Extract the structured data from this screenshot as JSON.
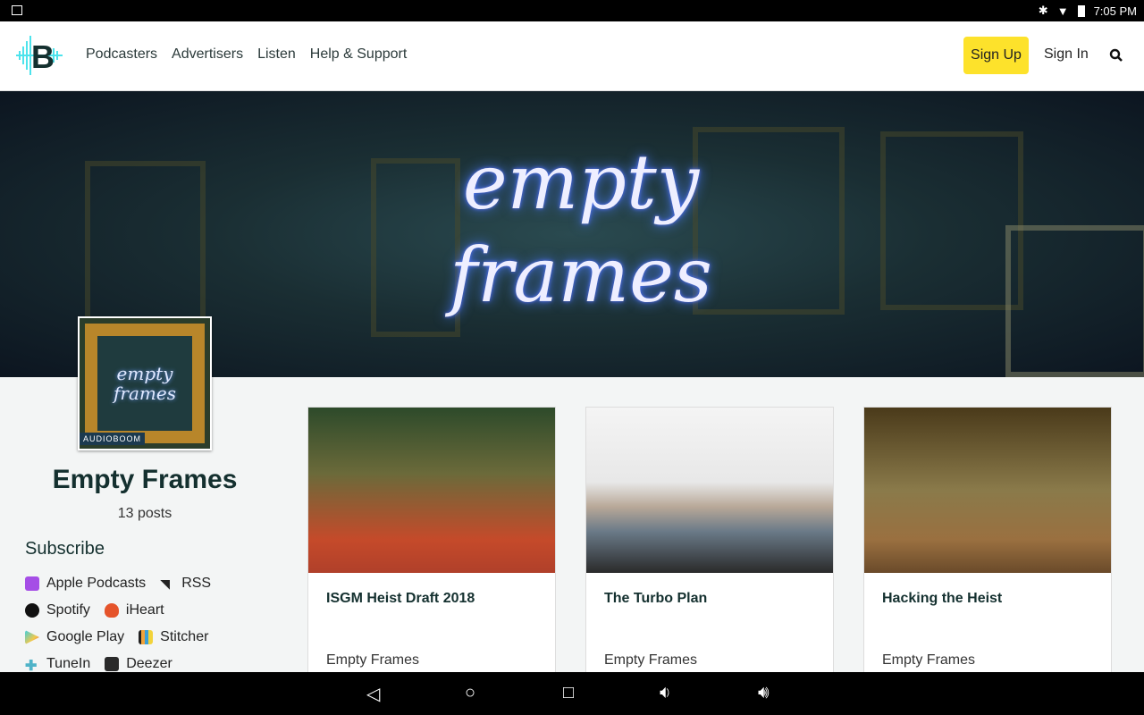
{
  "status": {
    "time": "7:05 PM"
  },
  "nav": {
    "links": [
      "Podcasters",
      "Advertisers",
      "Listen",
      "Help & Support"
    ],
    "sign_up": "Sign Up",
    "sign_in": "Sign In",
    "accent": "#fde22b"
  },
  "hero": {
    "title_line1": "empty",
    "title_line2": "frames"
  },
  "podcast": {
    "cover_line1": "empty",
    "cover_line2": "frames",
    "cover_badge": "AUDIOBOOM",
    "name": "Empty Frames",
    "posts": "13 posts"
  },
  "subscribe": {
    "heading": "Subscribe",
    "items": [
      {
        "label": "Apple Podcasts",
        "icon": "apple-podcasts-icon"
      },
      {
        "label": "RSS",
        "icon": "rss-icon"
      },
      {
        "label": "Spotify",
        "icon": "spotify-icon"
      },
      {
        "label": "iHeart",
        "icon": "iheart-icon"
      },
      {
        "label": "Google Play",
        "icon": "google-play-icon"
      },
      {
        "label": "Stitcher",
        "icon": "stitcher-icon"
      },
      {
        "label": "TuneIn",
        "icon": "tunein-icon"
      },
      {
        "label": "Deezer",
        "icon": "deezer-icon"
      }
    ]
  },
  "episodes": [
    {
      "title": "ISGM Heist Draft 2018",
      "author": "Empty Frames"
    },
    {
      "title": "The Turbo Plan",
      "author": "Empty Frames"
    },
    {
      "title": "Hacking the Heist",
      "author": "Empty Frames"
    }
  ]
}
